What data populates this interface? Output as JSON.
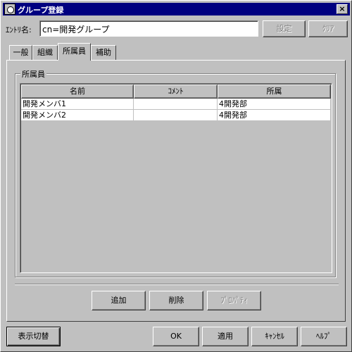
{
  "window": {
    "title": "グループ登録",
    "close_glyph": "×"
  },
  "entry": {
    "label": "ｴﾝﾄﾘ名:",
    "value": "cn=開発グループ"
  },
  "top_buttons": {
    "set_label": "設定",
    "clear_label": "ｸﾘｱ"
  },
  "tabs": [
    {
      "label": "一般"
    },
    {
      "label": "組織"
    },
    {
      "label": "所属員"
    },
    {
      "label": "補助"
    }
  ],
  "active_tab": "所属員",
  "members": {
    "group_label": "所属員",
    "columns": [
      "名前",
      "ｺﾒﾝﾄ",
      "所属"
    ],
    "rows": [
      [
        "開発メンバ1",
        "",
        "4開発部"
      ],
      [
        "開発メンバ2",
        "",
        "4開発部"
      ]
    ]
  },
  "member_buttons": {
    "add_label": "追加",
    "delete_label": "削除",
    "property_label": "ﾌﾟﾛﾊﾟﾃｨ"
  },
  "bottom_buttons": {
    "toggle_label": "表示切替",
    "ok_label": "OK",
    "apply_label": "適用",
    "cancel_label": "ｷｬﾝｾﾙ",
    "help_label": "ﾍﾙﾌﾟ"
  }
}
